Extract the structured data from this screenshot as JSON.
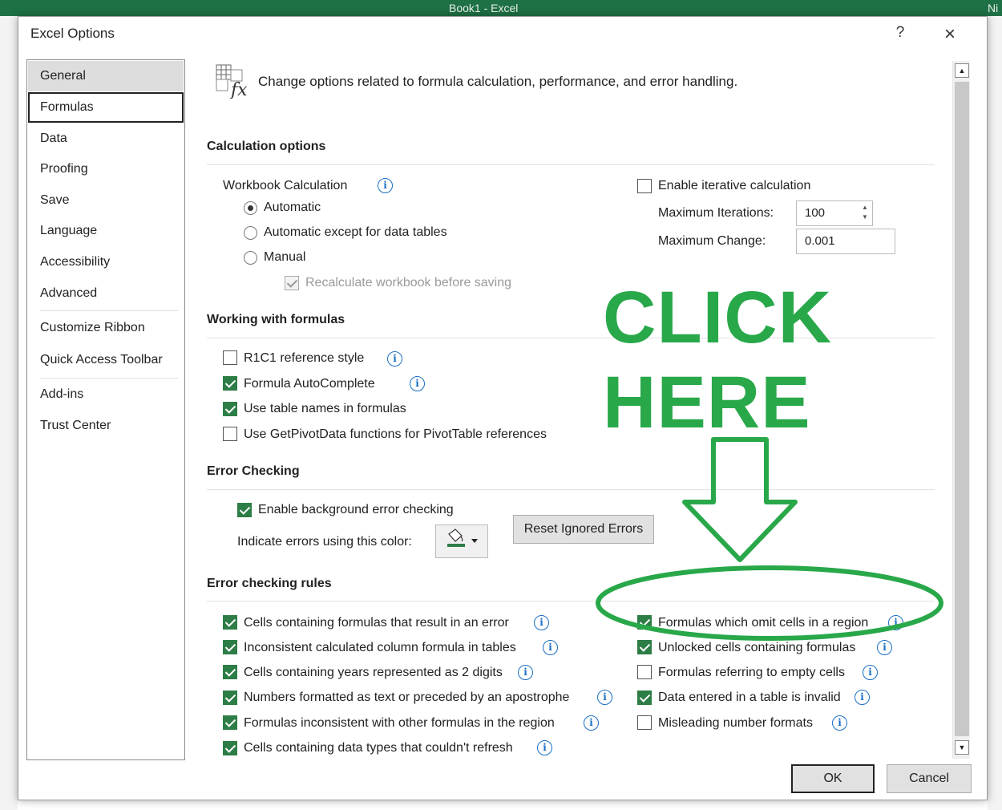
{
  "app_title": "Book1 - Excel",
  "app_title_right": "Ni",
  "dialog": {
    "title": "Excel Options",
    "help": "?",
    "close": "×"
  },
  "nav": {
    "items": [
      {
        "label": "General",
        "state": "highlighted"
      },
      {
        "label": "Formulas",
        "state": "selected"
      },
      {
        "label": "Data"
      },
      {
        "label": "Proofing"
      },
      {
        "label": "Save"
      },
      {
        "label": "Language"
      },
      {
        "label": "Accessibility"
      },
      {
        "label": "Advanced"
      },
      {
        "label": "Customize Ribbon"
      },
      {
        "label": "Quick Access Toolbar"
      },
      {
        "label": "Add-ins"
      },
      {
        "label": "Trust Center"
      }
    ]
  },
  "header": {
    "text": "Change options related to formula calculation, performance, and error handling."
  },
  "calculation": {
    "section_title": "Calculation options",
    "workbook_calculation": "Workbook Calculation",
    "modes": [
      {
        "label": "Automatic",
        "selected": true
      },
      {
        "label": "Automatic except for data tables",
        "selected": false
      },
      {
        "label": "Manual",
        "selected": false
      }
    ],
    "recalculate": {
      "label": "Recalculate workbook before saving",
      "checked": true,
      "disabled": true
    },
    "iterative": {
      "label": "Enable iterative calculation",
      "checked": false
    },
    "max_iterations": {
      "label": "Maximum Iterations:",
      "value": "100"
    },
    "max_change": {
      "label": "Maximum Change:",
      "value": "0.001"
    }
  },
  "formulas": {
    "section_title": "Working with formulas",
    "options": [
      {
        "label": "R1C1 reference style",
        "checked": false,
        "info": true
      },
      {
        "label": "Formula AutoComplete",
        "checked": true,
        "info": true
      },
      {
        "label": "Use table names in formulas",
        "checked": true,
        "info": false
      },
      {
        "label": "Use GetPivotData functions for PivotTable references",
        "checked": false,
        "info": false
      }
    ]
  },
  "error_checking": {
    "section_title": "Error Checking",
    "enable": {
      "label": "Enable background error checking",
      "checked": true
    },
    "indicate": {
      "label": "Indicate errors using this color:",
      "color": "#2d7d46"
    },
    "reset_button": "Reset Ignored Errors"
  },
  "rules": {
    "section_title": "Error checking rules",
    "left": [
      {
        "label": "Cells containing formulas that result in an error",
        "checked": true
      },
      {
        "label": "Inconsistent calculated column formula in tables",
        "checked": true
      },
      {
        "label": "Cells containing years represented as 2 digits",
        "checked": true
      },
      {
        "label": "Numbers formatted as text or preceded by an apostrophe",
        "checked": true
      },
      {
        "label": "Formulas inconsistent with other formulas in the region",
        "checked": true
      },
      {
        "label": "Cells containing data types that couldn't refresh",
        "checked": true
      }
    ],
    "right": [
      {
        "label": "Formulas which omit cells in a region",
        "checked": true
      },
      {
        "label": "Unlocked cells containing formulas",
        "checked": true
      },
      {
        "label": "Formulas referring to empty cells",
        "checked": false
      },
      {
        "label": "Data entered in a table is invalid",
        "checked": true
      },
      {
        "label": "Misleading number formats",
        "checked": false
      }
    ]
  },
  "annotation": {
    "line1": "CLICK",
    "line2": "HERE",
    "color": "#29a84a"
  },
  "buttons": {
    "ok": "OK",
    "cancel": "Cancel"
  },
  "colors": {
    "excel_green": "#1e7145",
    "checkbox_green": "#2d7d46",
    "info_blue": "#1a6fc4"
  }
}
